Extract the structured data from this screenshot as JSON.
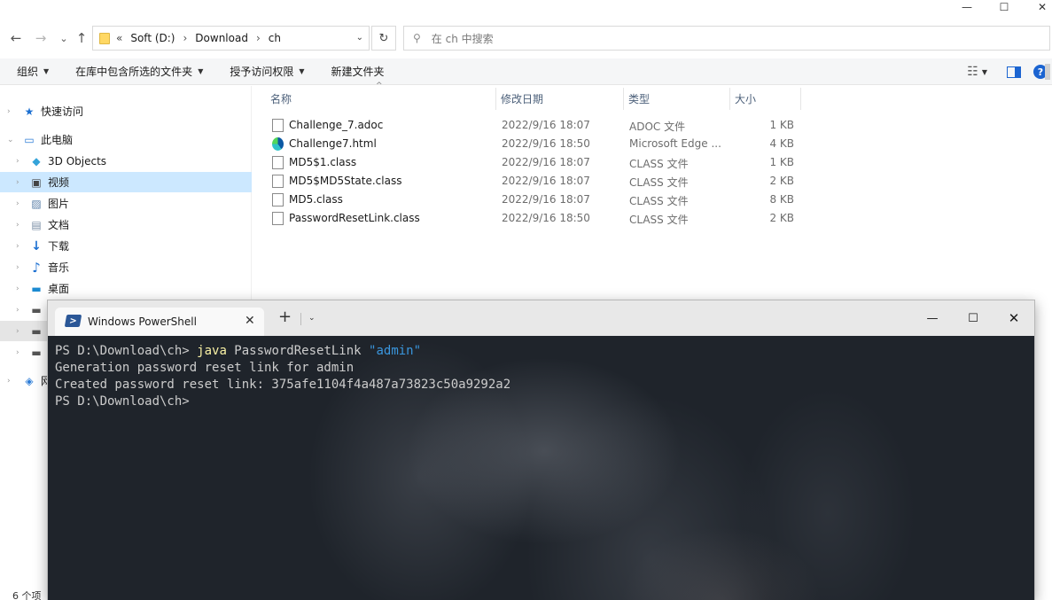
{
  "explorer": {
    "window_controls": {
      "minimize": "—",
      "maximize": "☐",
      "close": "✕"
    },
    "nav_buttons": {
      "back": "←",
      "forward": "→",
      "recent": "⌄",
      "up": "↑"
    },
    "address": {
      "overflow": "«",
      "crumbs": [
        "Soft (D:)",
        "Download",
        "ch"
      ],
      "separator": "›",
      "dropdown": "⌄",
      "refresh": "↻"
    },
    "search": {
      "icon": "⚲",
      "placeholder": "在 ch 中搜索"
    },
    "commandbar": {
      "organize": "组织",
      "include_library": "在库中包含所选的文件夹",
      "share_with": "授予访问权限",
      "new_folder": "新建文件夹",
      "view_icon": "☷",
      "help": "?"
    },
    "nav": [
      {
        "label": "快速访问",
        "icon": "star-icon",
        "glyph": "★"
      },
      {
        "label": "此电脑",
        "icon": "computer-icon",
        "glyph": "▭"
      },
      {
        "label": "3D Objects",
        "icon": "cube-icon",
        "glyph": "◆"
      },
      {
        "label": "视频",
        "icon": "video-icon",
        "glyph": "▣"
      },
      {
        "label": "图片",
        "icon": "picture-icon",
        "glyph": "▨"
      },
      {
        "label": "文档",
        "icon": "document-icon",
        "glyph": "▤"
      },
      {
        "label": "下载",
        "icon": "download-icon",
        "glyph": "↓"
      },
      {
        "label": "音乐",
        "icon": "music-icon",
        "glyph": "♪"
      },
      {
        "label": "桌面",
        "icon": "desktop-icon",
        "glyph": "▬"
      },
      {
        "label": "",
        "icon": "drive-icon",
        "glyph": "▬"
      },
      {
        "label": "",
        "icon": "drive-icon",
        "glyph": "▬"
      },
      {
        "label": "",
        "icon": "drive-icon",
        "glyph": "▬"
      },
      {
        "label": "网",
        "icon": "network-icon",
        "glyph": "◈"
      }
    ],
    "columns": {
      "name": "名称",
      "date": "修改日期",
      "type": "类型",
      "size": "大小",
      "sort_caret": "^"
    },
    "files": [
      {
        "name": "Challenge_7.adoc",
        "date": "2022/9/16 18:07",
        "type": "ADOC 文件",
        "size": "1 KB",
        "icon": "file-icon"
      },
      {
        "name": "Challenge7.html",
        "date": "2022/9/16 18:50",
        "type": "Microsoft Edge ...",
        "size": "4 KB",
        "icon": "edge-icon"
      },
      {
        "name": "MD5$1.class",
        "date": "2022/9/16 18:07",
        "type": "CLASS 文件",
        "size": "1 KB",
        "icon": "file-icon"
      },
      {
        "name": "MD5$MD5State.class",
        "date": "2022/9/16 18:07",
        "type": "CLASS 文件",
        "size": "2 KB",
        "icon": "file-icon"
      },
      {
        "name": "MD5.class",
        "date": "2022/9/16 18:07",
        "type": "CLASS 文件",
        "size": "8 KB",
        "icon": "file-icon"
      },
      {
        "name": "PasswordResetLink.class",
        "date": "2022/9/16 18:50",
        "type": "CLASS 文件",
        "size": "2 KB",
        "icon": "file-icon"
      }
    ],
    "status": "6 个项"
  },
  "terminal": {
    "tab_title": "Windows PowerShell",
    "tab_close": "✕",
    "new_tab": "+",
    "dropdown": "⌄",
    "window_controls": {
      "minimize": "—",
      "maximize": "☐",
      "close": "✕"
    },
    "lines": [
      {
        "prompt": "PS D:\\Download\\ch> ",
        "cmd": "java",
        "args": " PasswordResetLink ",
        "str": "\"admin\""
      },
      {
        "text": "Generation password reset link for admin"
      },
      {
        "text": "Created password reset link: 375afe1104f4a487a73823c50a9292a2"
      },
      {
        "prompt": "PS D:\\Download\\ch>"
      }
    ],
    "colors": {
      "background": "#1f242b",
      "text": "#cccccc",
      "command": "#f9f1a5",
      "string": "#3a96dd"
    }
  }
}
